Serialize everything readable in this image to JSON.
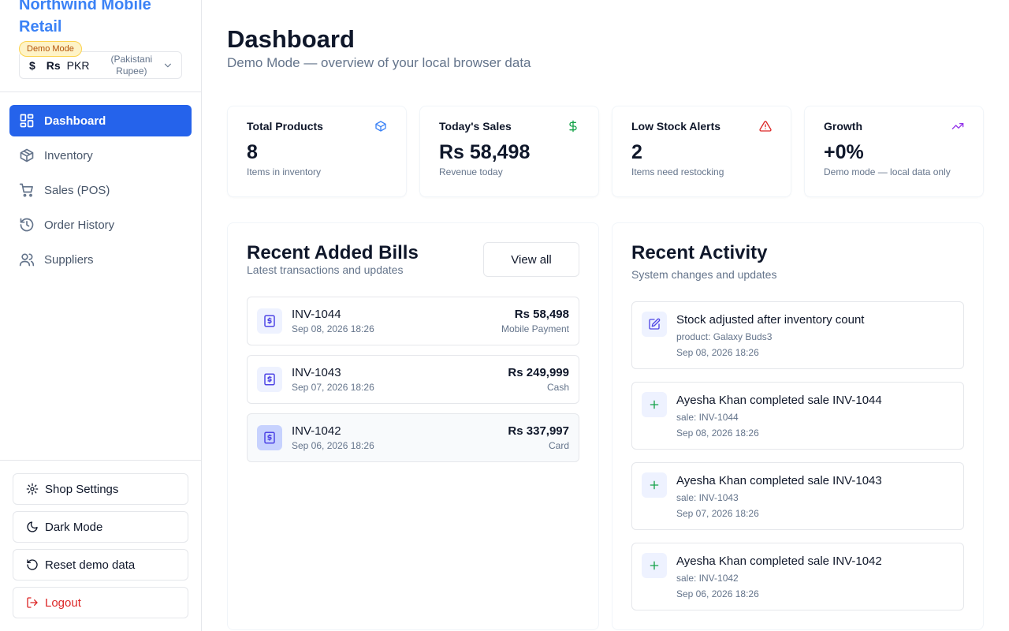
{
  "brand": {
    "name": "Northwind Mobile Retail",
    "badge": "Demo Mode"
  },
  "currency": {
    "symbol": "Rs",
    "code": "PKR",
    "name": "(Pakistani Rupee)",
    "icon": "dollar-icon"
  },
  "nav": [
    {
      "label": "Dashboard",
      "icon": "dashboard-icon",
      "active": true
    },
    {
      "label": "Inventory",
      "icon": "package-icon",
      "active": false
    },
    {
      "label": "Sales (POS)",
      "icon": "cart-icon",
      "active": false
    },
    {
      "label": "Order History",
      "icon": "history-icon",
      "active": false
    },
    {
      "label": "Suppliers",
      "icon": "users-icon",
      "active": false
    }
  ],
  "sidebar_actions": {
    "settings": "Shop Settings",
    "dark_mode": "Dark Mode",
    "reset": "Reset demo data",
    "logout": "Logout"
  },
  "header": {
    "title": "Dashboard",
    "subtitle": "Demo Mode — overview of your local browser data"
  },
  "stats": [
    {
      "label": "Total Products",
      "value": "8",
      "desc": "Items in inventory",
      "icon": "package-icon",
      "color": "#3b82f6"
    },
    {
      "label": "Today's Sales",
      "value": "Rs 58,498",
      "desc": "Revenue today",
      "icon": "dollar-icon",
      "color": "#16a34a"
    },
    {
      "label": "Low Stock Alerts",
      "value": "2",
      "desc": "Items need restocking",
      "icon": "alert-triangle-icon",
      "color": "#dc2626"
    },
    {
      "label": "Growth",
      "value": "+0%",
      "desc": "Demo mode — local data only",
      "icon": "trending-up-icon",
      "color": "#9333ea"
    }
  ],
  "bills": {
    "title": "Recent Added Bills",
    "subtitle": "Latest transactions and updates",
    "view_all": "View all",
    "items": [
      {
        "invoice": "INV-1044",
        "date": "Sep 08, 2026 18:26",
        "amount": "Rs 58,498",
        "method": "Mobile Payment"
      },
      {
        "invoice": "INV-1043",
        "date": "Sep 07, 2026 18:26",
        "amount": "Rs 249,999",
        "method": "Cash"
      },
      {
        "invoice": "INV-1042",
        "date": "Sep 06, 2026 18:26",
        "amount": "Rs 337,997",
        "method": "Card"
      }
    ]
  },
  "activity": {
    "title": "Recent Activity",
    "subtitle": "System changes and updates",
    "items": [
      {
        "title": "Stock adjusted after inventory count",
        "detail": "product: Galaxy Buds3",
        "date": "Sep 08, 2026 18:26",
        "icon": "edit-icon"
      },
      {
        "title": "Ayesha Khan completed sale INV-1044",
        "detail": "sale: INV-1044",
        "date": "Sep 08, 2026 18:26",
        "icon": "plus-icon"
      },
      {
        "title": "Ayesha Khan completed sale INV-1043",
        "detail": "sale: INV-1043",
        "date": "Sep 07, 2026 18:26",
        "icon": "plus-icon"
      },
      {
        "title": "Ayesha Khan completed sale INV-1042",
        "detail": "sale: INV-1042",
        "date": "Sep 06, 2026 18:26",
        "icon": "plus-icon"
      }
    ]
  },
  "colors": {
    "accent": "#2563eb",
    "brand": "#3b82f6",
    "danger": "#dc2626",
    "success": "#16a34a",
    "purple": "#9333ea"
  }
}
